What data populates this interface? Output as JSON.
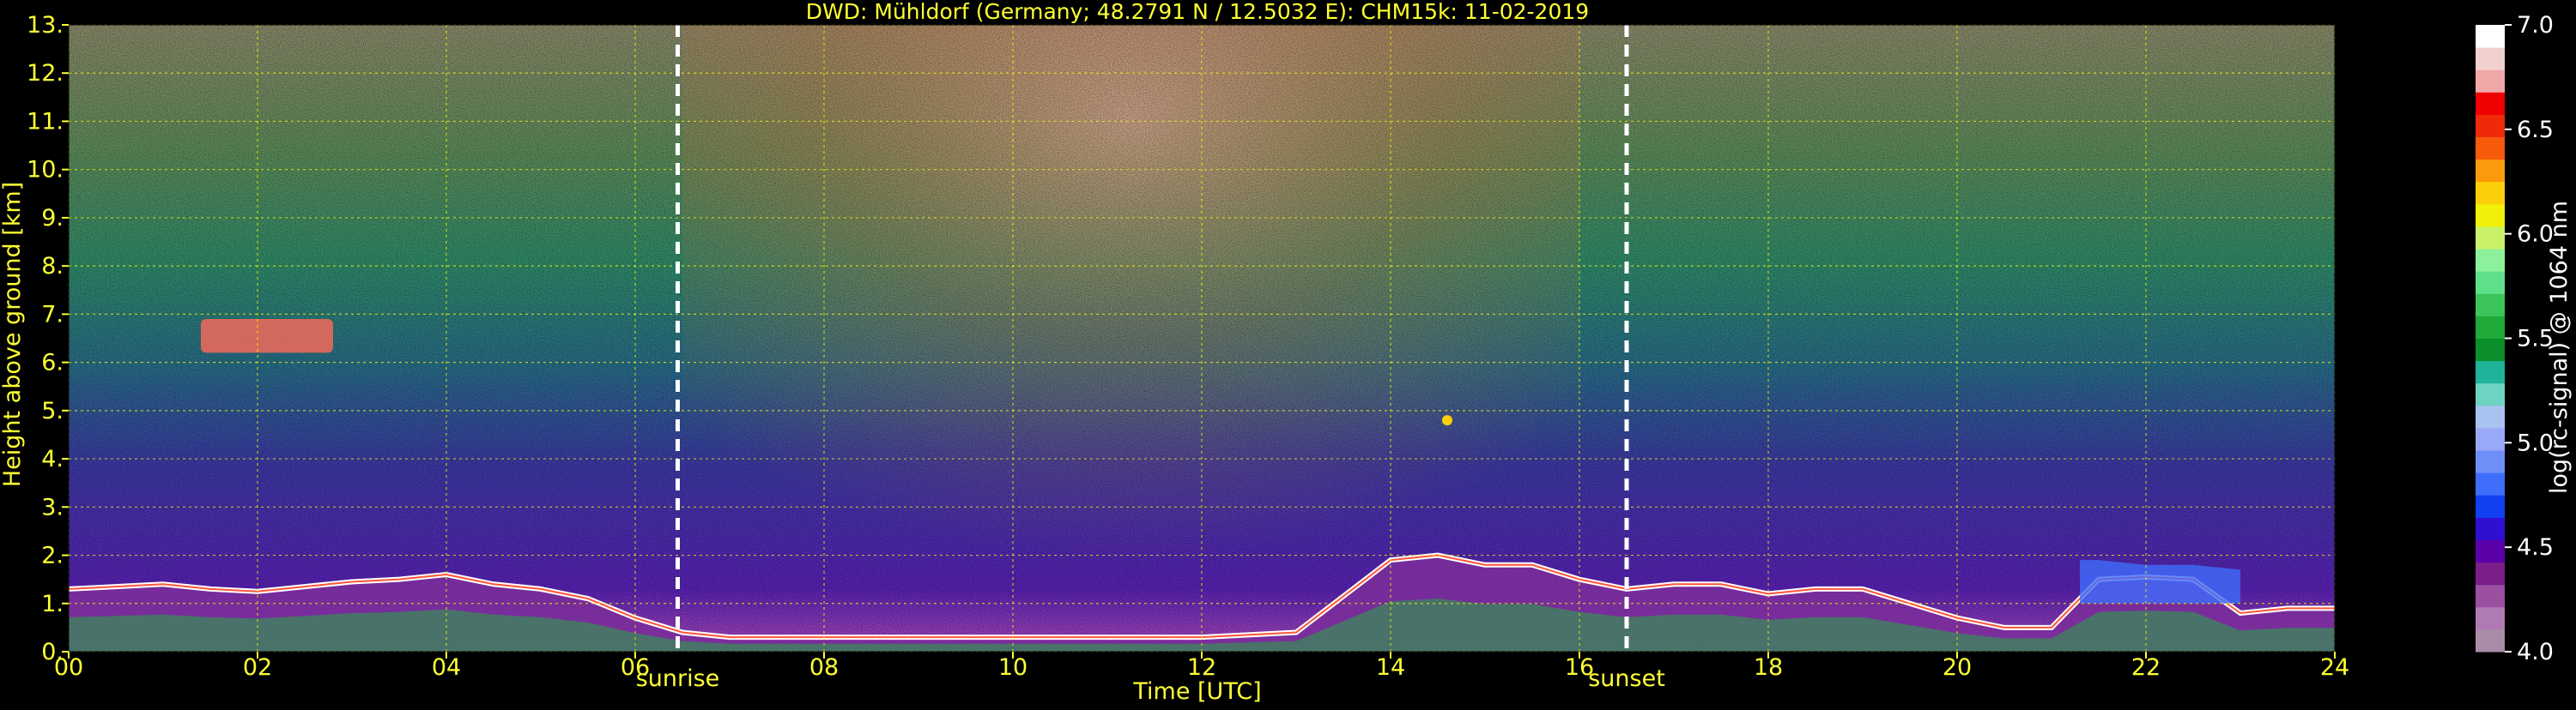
{
  "chart_data": {
    "type": "heatmap",
    "title": "DWD: Mühldorf (Germany; 48.2791 N / 12.5032 E):    CHM15k: 11-02-2019",
    "xlabel": "Time [UTC]",
    "ylabel": "Height above ground [km]",
    "xlim": [
      0,
      24
    ],
    "ylim": [
      0,
      13
    ],
    "x_ticks": [
      0,
      2,
      4,
      6,
      8,
      10,
      12,
      14,
      16,
      18,
      20,
      22,
      24
    ],
    "x_tick_labels": [
      "00",
      "02",
      "04",
      "06",
      "08",
      "10",
      "12",
      "14",
      "16",
      "18",
      "20",
      "22",
      "24"
    ],
    "y_ticks": [
      0,
      1,
      2,
      3,
      4,
      5,
      6,
      7,
      8,
      9,
      10,
      11,
      12,
      13
    ],
    "y_tick_labels": [
      "0.",
      "1.",
      "2.",
      "3.",
      "4.",
      "5.",
      "6.",
      "7.",
      "8.",
      "9.",
      "10.",
      "11.",
      "12.",
      "13."
    ],
    "grid": true,
    "markers": [
      {
        "label": "sunrise",
        "x": 6.45
      },
      {
        "label": "sunset",
        "x": 16.5
      }
    ],
    "colorbar": {
      "label": "log(rc-signal) @ 1064 nm",
      "range": [
        4.0,
        7.0
      ],
      "ticks": [
        4.0,
        4.5,
        5.0,
        5.5,
        6.0,
        6.5,
        7.0
      ],
      "tick_labels": [
        "4.0",
        "4.5",
        "5.0",
        "5.5",
        "6.0",
        "6.5",
        "7.0"
      ],
      "colors": [
        "#a88ca8",
        "#b07ab4",
        "#9a4fa0",
        "#7b1e8a",
        "#5a00a8",
        "#3010d0",
        "#1040f0",
        "#3f6dfc",
        "#6f8ff8",
        "#9aa8f8",
        "#a9c3f0",
        "#6fd3c3",
        "#1fb39a",
        "#0a8f2a",
        "#1faa3a",
        "#3ac45a",
        "#5ee08a",
        "#8df09a",
        "#c9f26a",
        "#f1f00a",
        "#fbd00a",
        "#fb9a0a",
        "#f65a0a",
        "#ee2a0a",
        "#f00000",
        "#f0a8a8",
        "#f2d0d0",
        "#ffffff"
      ]
    },
    "series": [
      {
        "name": "boundary layer top",
        "x": [
          0,
          0.5,
          1,
          1.5,
          2,
          2.5,
          3,
          3.5,
          4,
          4.5,
          5,
          5.5,
          6,
          6.5,
          7,
          7.5,
          8,
          9,
          10,
          11,
          12,
          13,
          14,
          14.5,
          15,
          15.5,
          16,
          16.5,
          17,
          17.5,
          18,
          18.5,
          19,
          19.5,
          20,
          20.5,
          21,
          21.5,
          22,
          22.5,
          23,
          23.5,
          24
        ],
        "y": [
          1.3,
          1.35,
          1.4,
          1.3,
          1.25,
          1.35,
          1.45,
          1.5,
          1.6,
          1.4,
          1.3,
          1.1,
          0.7,
          0.4,
          0.3,
          0.3,
          0.3,
          0.3,
          0.3,
          0.3,
          0.3,
          0.4,
          1.9,
          2.0,
          1.8,
          1.8,
          1.5,
          1.3,
          1.4,
          1.4,
          1.2,
          1.3,
          1.3,
          1.0,
          0.7,
          0.5,
          0.5,
          1.5,
          1.55,
          1.5,
          0.8,
          0.9,
          0.9
        ]
      },
      {
        "name": "elevated aerosol layer",
        "x": [
          21.3,
          21.5,
          22,
          22.5,
          23
        ],
        "y": [
          1.9,
          1.9,
          1.8,
          1.8,
          1.7
        ]
      }
    ],
    "features": [
      {
        "name": "cirrus patch",
        "x_range": [
          1.4,
          2.8
        ],
        "y_range": [
          6.2,
          6.9
        ]
      },
      {
        "name": "small cloud",
        "x": 14.6,
        "y": 4.8
      }
    ]
  }
}
